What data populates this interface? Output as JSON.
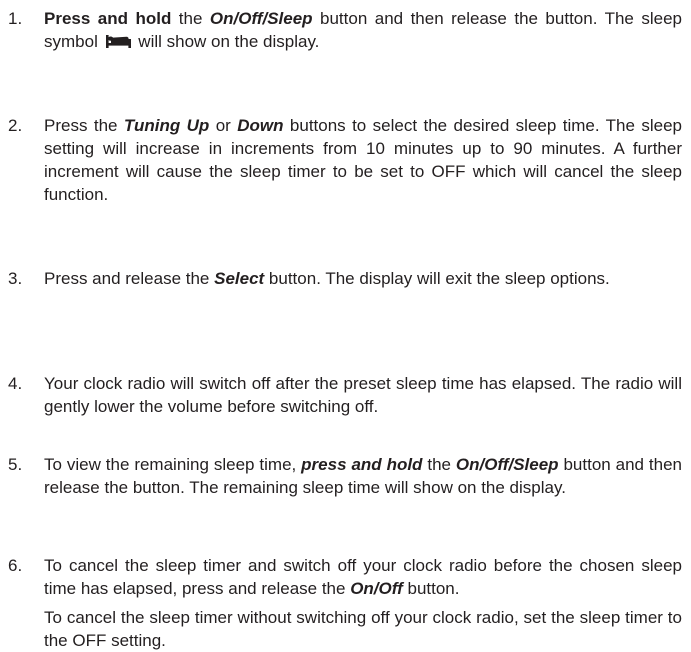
{
  "steps": [
    {
      "number": "1.",
      "paragraphs": [
        [
          {
            "text": "Press and hold",
            "style": "b"
          },
          {
            "text": " the ",
            "style": ""
          },
          {
            "text": "On/Off/Sleep",
            "style": "bi"
          },
          {
            "text": " button and then release the button. The sleep symbol ",
            "style": ""
          },
          {
            "icon": "sleep-symbol-icon"
          },
          {
            "text": " will show on the display.",
            "style": ""
          }
        ]
      ]
    },
    {
      "number": "2.",
      "paragraphs": [
        [
          {
            "text": "Press the ",
            "style": ""
          },
          {
            "text": "Tuning Up",
            "style": "bi"
          },
          {
            "text": " or ",
            "style": ""
          },
          {
            "text": "Down",
            "style": "bi"
          },
          {
            "text": " buttons to select the desired sleep time. The sleep setting will increase in increments from 10 minutes up to 90 minutes. A further increment will cause the sleep timer to be set to OFF which will cancel the sleep function.",
            "style": ""
          }
        ]
      ]
    },
    {
      "number": "3.",
      "paragraphs": [
        [
          {
            "text": "Press and release the ",
            "style": ""
          },
          {
            "text": "Select",
            "style": "bi"
          },
          {
            "text": " button. The display will exit the sleep options.",
            "style": ""
          }
        ]
      ]
    },
    {
      "number": "4.",
      "paragraphs": [
        [
          {
            "text": "Your clock radio will switch off after the preset sleep time has elapsed. The radio will gently lower the volume before switching off.",
            "style": ""
          }
        ]
      ]
    },
    {
      "number": "5.",
      "paragraphs": [
        [
          {
            "text": "To view the remaining sleep time, ",
            "style": ""
          },
          {
            "text": "press and hold",
            "style": "bi"
          },
          {
            "text": " the ",
            "style": ""
          },
          {
            "text": "On/Off/Sleep",
            "style": "bi"
          },
          {
            "text": " button and then release the button. The remaining sleep time will show on the display.",
            "style": ""
          }
        ]
      ]
    },
    {
      "number": "6.",
      "paragraphs": [
        [
          {
            "text": "To cancel the sleep timer and switch off your clock radio before the chosen sleep time has elapsed, press and release the ",
            "style": ""
          },
          {
            "text": "On/Off",
            "style": "bi"
          },
          {
            "text": " button.",
            "style": ""
          }
        ],
        [
          {
            "text": "To cancel the sleep timer without switching off your clock radio, set the sleep timer to the OFF setting.",
            "style": ""
          }
        ]
      ]
    }
  ]
}
